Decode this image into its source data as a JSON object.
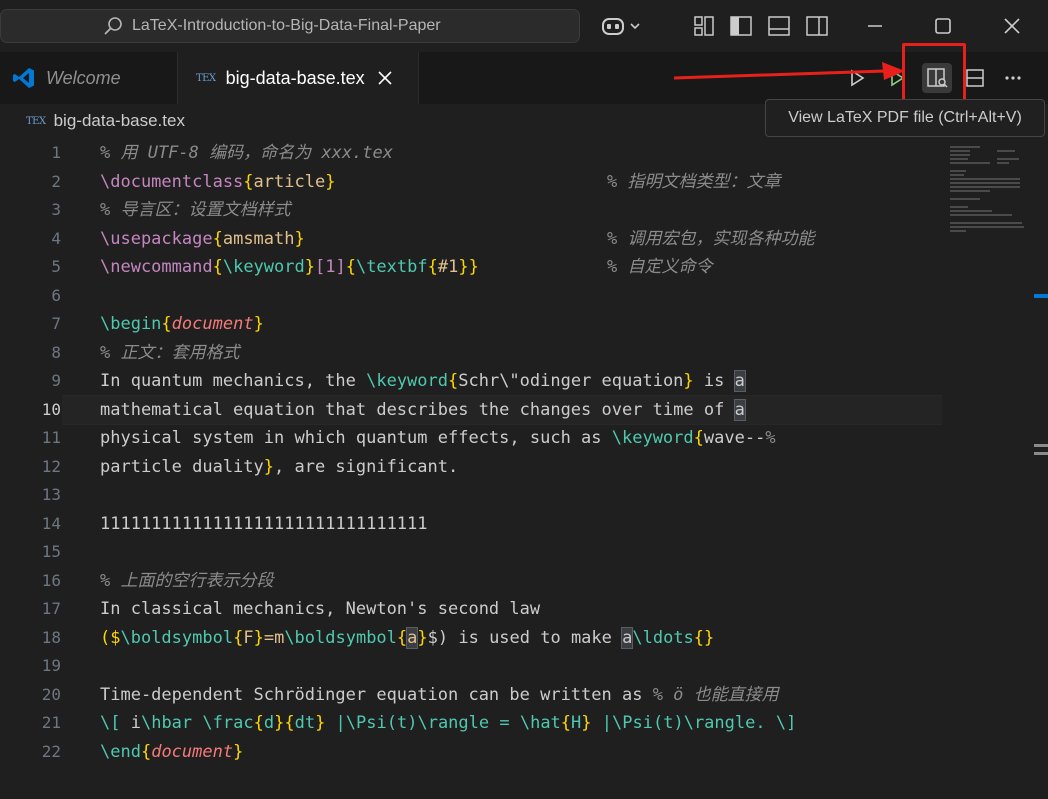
{
  "window": {
    "search_title": "LaTeX-Introduction-to-Big-Data-Final-Paper",
    "icons": [
      "search-icon",
      "copilot-icon",
      "layout-icon",
      "toggle-sidebar-icon",
      "toggle-panel-icon",
      "toggle-secondary-sidebar-icon",
      "minimize-icon",
      "maximize-icon",
      "close-icon"
    ]
  },
  "tabs": [
    {
      "label": "Welcome",
      "icon": "vscode-icon"
    },
    {
      "label": "big-data-base.tex",
      "icon": "tex-icon"
    }
  ],
  "tex_icon_text": "TEX",
  "breadcrumb": {
    "file": "big-data-base.tex"
  },
  "tooltip": {
    "text": "View LaTeX PDF file (Ctrl+Alt+V)"
  },
  "colors": {
    "annotation": "#e8201c",
    "accent": "#0078d4"
  },
  "editor": {
    "current_line": 10,
    "lines": [
      {
        "n": "1"
      },
      {
        "n": "2"
      },
      {
        "n": "3"
      },
      {
        "n": "4"
      },
      {
        "n": "5"
      },
      {
        "n": "6"
      },
      {
        "n": "7"
      },
      {
        "n": "8"
      },
      {
        "n": "9"
      },
      {
        "n": "10"
      },
      {
        "n": "11"
      },
      {
        "n": "12"
      },
      {
        "n": "13"
      },
      {
        "n": "14"
      },
      {
        "n": "15"
      },
      {
        "n": "16"
      },
      {
        "n": "17"
      },
      {
        "n": "18"
      },
      {
        "n": "19"
      },
      {
        "n": "20"
      },
      {
        "n": "21"
      },
      {
        "n": "22"
      }
    ],
    "code": {
      "l1": "% 用 UTF-8 编码，命名为 xxx.tex",
      "l2_cmd": "\\documentclass",
      "l2_arg": "article",
      "l2_cmt": "% 指明文档类型：文章",
      "l3": "% 导言区：设置文档样式",
      "l4_cmd": "\\usepackage",
      "l4_arg": "amsmath",
      "l4_cmt": "% 调用宏包，实现各种功能",
      "l5_cmd": "\\newcommand",
      "l5_a": "\\keyword",
      "l5_b": "[1]",
      "l5_c": "\\textbf",
      "l5_d": "#1",
      "l5_cmt": "% 自定义命令",
      "l7_cmd": "\\begin",
      "l7_arg": "document",
      "l8": "% 正文：套用格式",
      "l9_a": "In quantum mechanics, the ",
      "l9_cmd": "\\keyword",
      "l9_b": "Schr\\\"odinger equation",
      "l9_c": " is ",
      "l9_d": "a",
      "l10_a": "mathematical equation that describes the changes over time of ",
      "l10_b": "a",
      "l11_a": "physical system in which quantum effects, such as ",
      "l11_cmd": "\\keyword",
      "l11_b": "wave--",
      "l11_c": "%",
      "l12_a": "particle duality",
      "l12_b": ", are significant.",
      "l14": "11111111111111111111111111111111",
      "l16": "% 上面的空行表示分段",
      "l17": "In classical mechanics, Newton's second law",
      "l18_a": "($",
      "l18_b": "\\boldsymbol",
      "l18_c": "F",
      "l18_d": "=m",
      "l18_e": "\\boldsymbol",
      "l18_f": "a",
      "l18_g": "$) is used to make ",
      "l18_h": "a",
      "l18_i": "\\ldots",
      "l18_j": "{}",
      "l20_a": "Time-dependent Schrödinger equation can be written as ",
      "l20_b": "% ö 也能直接用",
      "l21_a": "\\[",
      "l21_b": " i",
      "l21_c": "\\hbar",
      "l21_d": " ",
      "l21_e": "\\frac",
      "l21_f": "d",
      "l21_g": "dt",
      "l21_h": " |",
      "l21_i": "\\Psi",
      "l21_j": "(t)",
      "l21_k": "\\rangle",
      "l21_l": " = ",
      "l21_m": "\\hat",
      "l21_n": "H",
      "l21_o": " |",
      "l21_p": "\\Psi",
      "l21_q": "(t)",
      "l21_r": "\\rangle",
      "l21_s": ". ",
      "l21_t": "\\]",
      "l22_cmd": "\\end",
      "l22_arg": "document"
    }
  }
}
